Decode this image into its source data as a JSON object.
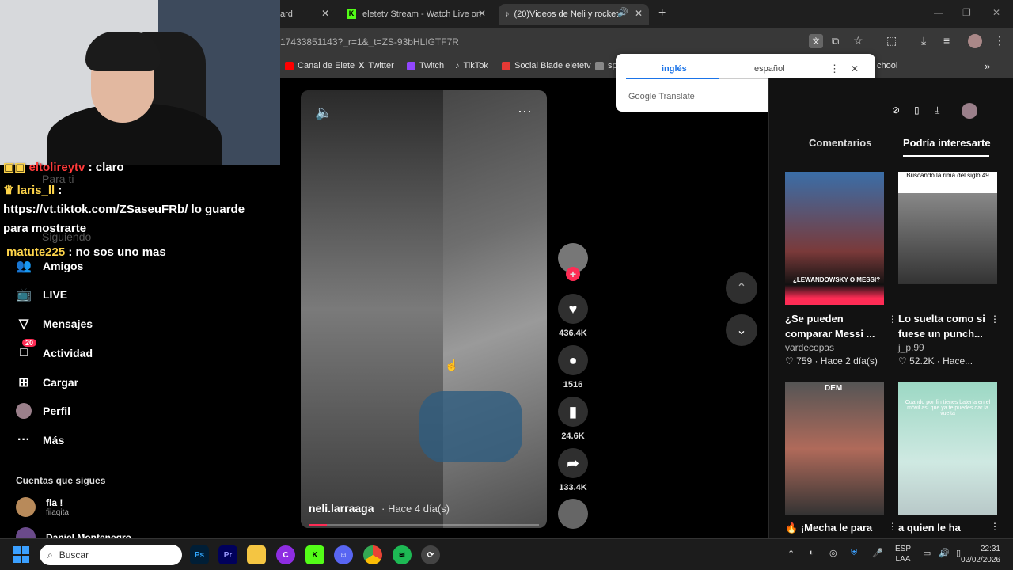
{
  "tabs": [
    {
      "label": "ard",
      "active": false
    },
    {
      "label": "eletetv Stream - Watch Live on",
      "active": false
    },
    {
      "label": "(20)Videos de Neli y rocket",
      "active": true
    }
  ],
  "address": {
    "url": "17433851143?_r=1&_t=ZS-93bHLIGTF7R"
  },
  "bookmarks": [
    {
      "label": "Canal de Elete",
      "color": "#ff0000"
    },
    {
      "label": "Twitter",
      "color": "#ffffff"
    },
    {
      "label": "Twitch",
      "color": "#9146ff"
    },
    {
      "label": "TikTok",
      "color": "#ffffff"
    },
    {
      "label": "Social Blade eletetv",
      "color": "#e53935"
    },
    {
      "label": "sp",
      "color": "#888888"
    },
    {
      "label": "chool",
      "color": "#888888"
    }
  ],
  "translate": {
    "lang_from": "inglés",
    "lang_to": "español",
    "brand": "Google Translate"
  },
  "chat": [
    {
      "user": "eltolireytv",
      "text": ": claro",
      "color": "#ff3b3b"
    },
    {
      "user": "laris_ll",
      "text": ":",
      "color": "#ffd54a"
    },
    {
      "user": "",
      "text": "https://vt.tiktok.com/ZSaseuFRb/ lo guarde",
      "color": "#ffffff"
    },
    {
      "user": "",
      "text": "para mostrarte",
      "color": "#ffffff"
    },
    {
      "user": "matute225",
      "text": ": no sos uno mas",
      "color": "#ffd54a"
    }
  ],
  "sidebar": {
    "ghost_items": [
      "Para ti",
      "Siguiendo"
    ],
    "items": [
      {
        "label": "Amigos",
        "icon": "friends-icon"
      },
      {
        "label": "LIVE",
        "icon": "live-icon"
      },
      {
        "label": "Mensajes",
        "icon": "messages-icon"
      },
      {
        "label": "Actividad",
        "icon": "activity-icon",
        "badge": "20"
      },
      {
        "label": "Cargar",
        "icon": "upload-icon"
      },
      {
        "label": "Perfil",
        "icon": "profile-icon"
      },
      {
        "label": "Más",
        "icon": "more-icon"
      }
    ],
    "following_title": "Cuentas que sigues",
    "following": [
      {
        "name": "fla !",
        "handle": "fiiaqita"
      },
      {
        "name": "Daniel Montenegro",
        "handle": ""
      }
    ]
  },
  "video": {
    "author": "neli.larraaga",
    "time": "· Hace 4 día(s)",
    "likes": "436.4K",
    "comments": "1516",
    "saves": "24.6K",
    "shares": "133.4K"
  },
  "rpanel": {
    "tabs": [
      "Comentarios",
      "Podría interesarte"
    ],
    "cards": [
      {
        "thumb_text": "¿LEWANDOWSKY O MESSI?",
        "title": "¿Se pueden comparar Messi ...",
        "author": "vardecopas",
        "likes": "759",
        "time": "Hace 2 día(s)"
      },
      {
        "thumb_text": "Buscando la rima del siglo 49",
        "title": "Lo suelta como si fuese un punch...",
        "author": "j_p.99",
        "likes": "52.2K",
        "time": "Hace..."
      },
      {
        "thumb_text": "DEM",
        "title": "¡Mecha le para",
        "author": "",
        "likes": "",
        "time": ""
      },
      {
        "thumb_text": "Cuando por fin tienes batería en el móvil así que ya te puedes dar la vuelta",
        "title": "a quien le ha",
        "author": "",
        "likes": "",
        "time": ""
      }
    ]
  },
  "taskbar": {
    "search": "Buscar",
    "lang": "ESP",
    "lang2": "LAA",
    "time": "22:31",
    "date": "02/02/2026"
  }
}
